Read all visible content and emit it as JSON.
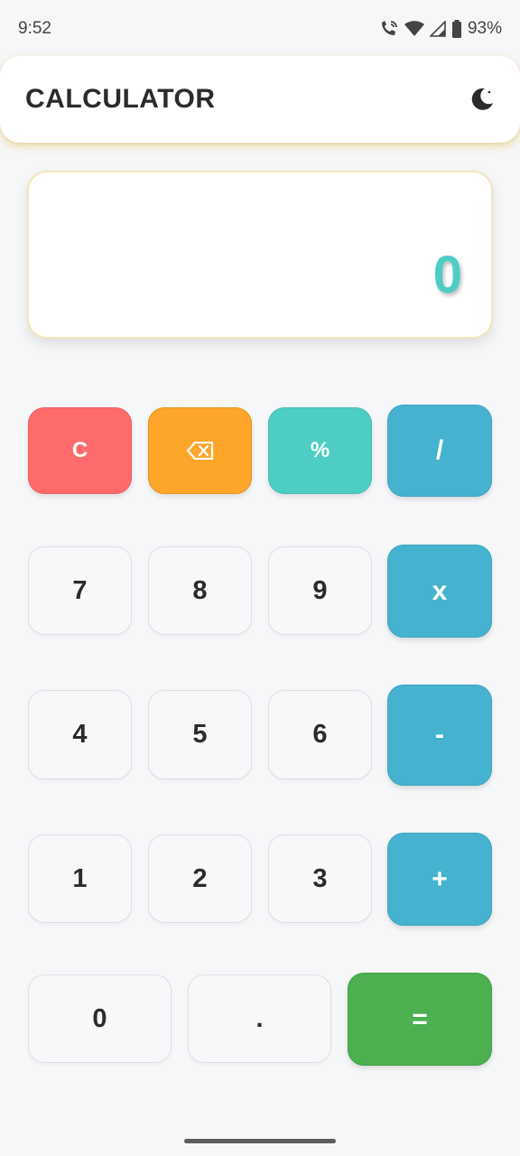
{
  "status_bar": {
    "time": "9:52",
    "battery": "93%",
    "icons": [
      "wifi-calling-icon",
      "wifi-icon",
      "signal-icon",
      "battery-icon"
    ]
  },
  "header": {
    "title": "CALCULATOR",
    "theme_icon": "moon-icon"
  },
  "display": {
    "value": "0",
    "value_color": "#4ecdc4"
  },
  "keypad": {
    "clear": "C",
    "backspace_icon": "backspace-icon",
    "percent": "%",
    "divide": "/",
    "multiply": "x",
    "subtract": "-",
    "add": "+",
    "equals": "=",
    "decimal": ".",
    "digits": {
      "zero": "0",
      "one": "1",
      "two": "2",
      "three": "3",
      "four": "4",
      "five": "5",
      "six": "6",
      "seven": "7",
      "eight": "8",
      "nine": "9"
    }
  },
  "colors": {
    "clear": "#ff6b6b",
    "backspace": "#fea62a",
    "percent": "#4ecdc4",
    "operator": "#45b3d0",
    "equals": "#4caf50",
    "background": "#f6f7f9"
  }
}
